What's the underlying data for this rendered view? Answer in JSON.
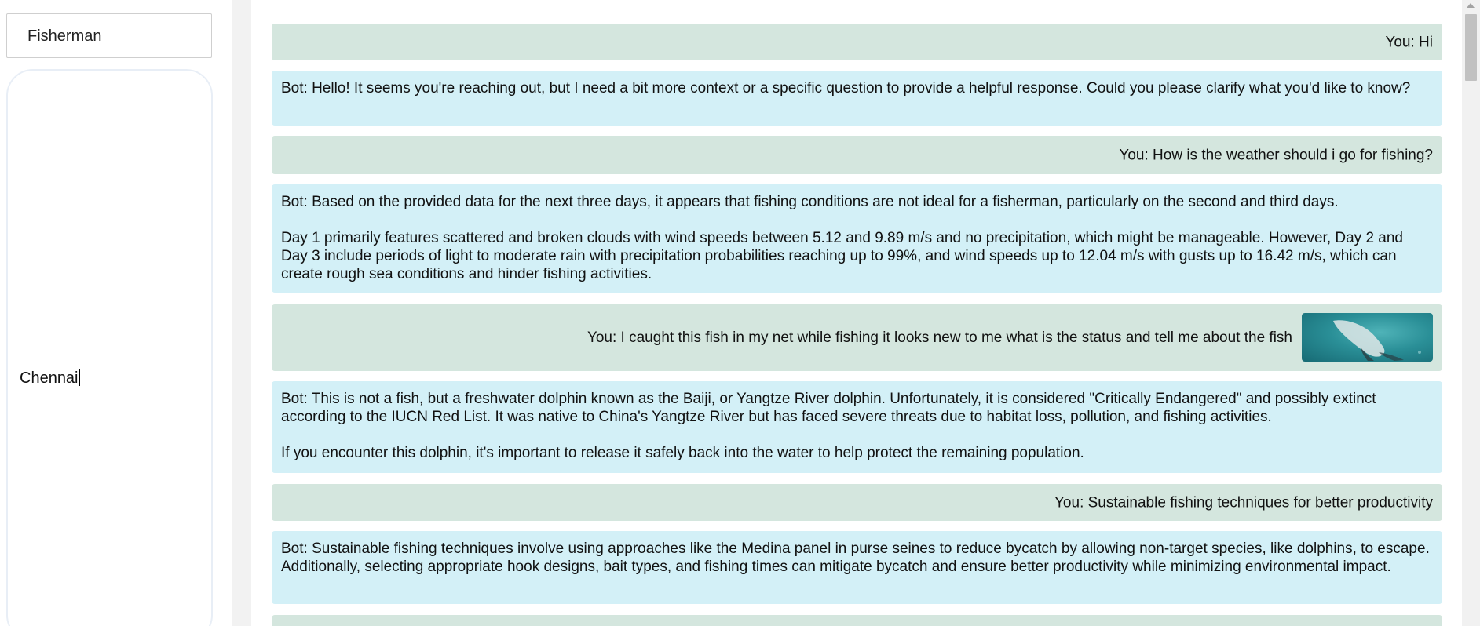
{
  "sidebar": {
    "role_value": "Fisherman",
    "location_value": "Chennai"
  },
  "messages": [
    {
      "role": "user",
      "text": "You: Hi"
    },
    {
      "role": "bot",
      "paragraphs": [
        "Bot: Hello! It seems you're reaching out, but I need a bit more context or a specific question to provide a helpful response. Could you please clarify what you'd like to know?"
      ]
    },
    {
      "role": "user",
      "text": "You: How is the weather should i go for fishing?"
    },
    {
      "role": "bot",
      "paragraphs": [
        "Bot: Based on the provided data for the next three days, it appears that fishing conditions are not ideal for a fisherman, particularly on the second and third days.",
        "Day 1 primarily features scattered and broken clouds with wind speeds between 5.12 and 9.89 m/s and no precipitation, which might be manageable. However, Day 2 and Day 3 include periods of light to moderate rain with precipitation probabilities reaching up to 99%, and wind speeds up to 12.04 m/s with gusts up to 16.42 m/s, which can create rough sea conditions and hinder fishing activities."
      ]
    },
    {
      "role": "user",
      "text": "You: I caught this fish in my net while fishing it looks new to me what is the status and tell me about the fish",
      "has_image": true
    },
    {
      "role": "bot",
      "paragraphs": [
        "Bot: This is not a fish, but a freshwater dolphin known as the Baiji, or Yangtze River dolphin. Unfortunately, it is considered \"Critically Endangered\" and possibly extinct according to the IUCN Red List. It was native to China's Yangtze River but has faced severe threats due to habitat loss, pollution, and fishing activities.",
        "If you encounter this dolphin, it's important to release it safely back into the water to help protect the remaining population."
      ]
    },
    {
      "role": "user",
      "text": "You: Sustainable fishing techniques for better productivity"
    },
    {
      "role": "bot",
      "paragraphs": [
        "Bot: Sustainable fishing techniques involve using approaches like the Medina panel in purse seines to reduce bycatch by allowing non-target species, like dolphins, to escape. Additionally, selecting appropriate hook designs, bait types, and fishing times can mitigate bycatch and ensure better productivity while minimizing environmental impact."
      ]
    }
  ],
  "colors": {
    "user_bubble": "#d4e6de",
    "bot_bubble": "#d3f0f7"
  }
}
